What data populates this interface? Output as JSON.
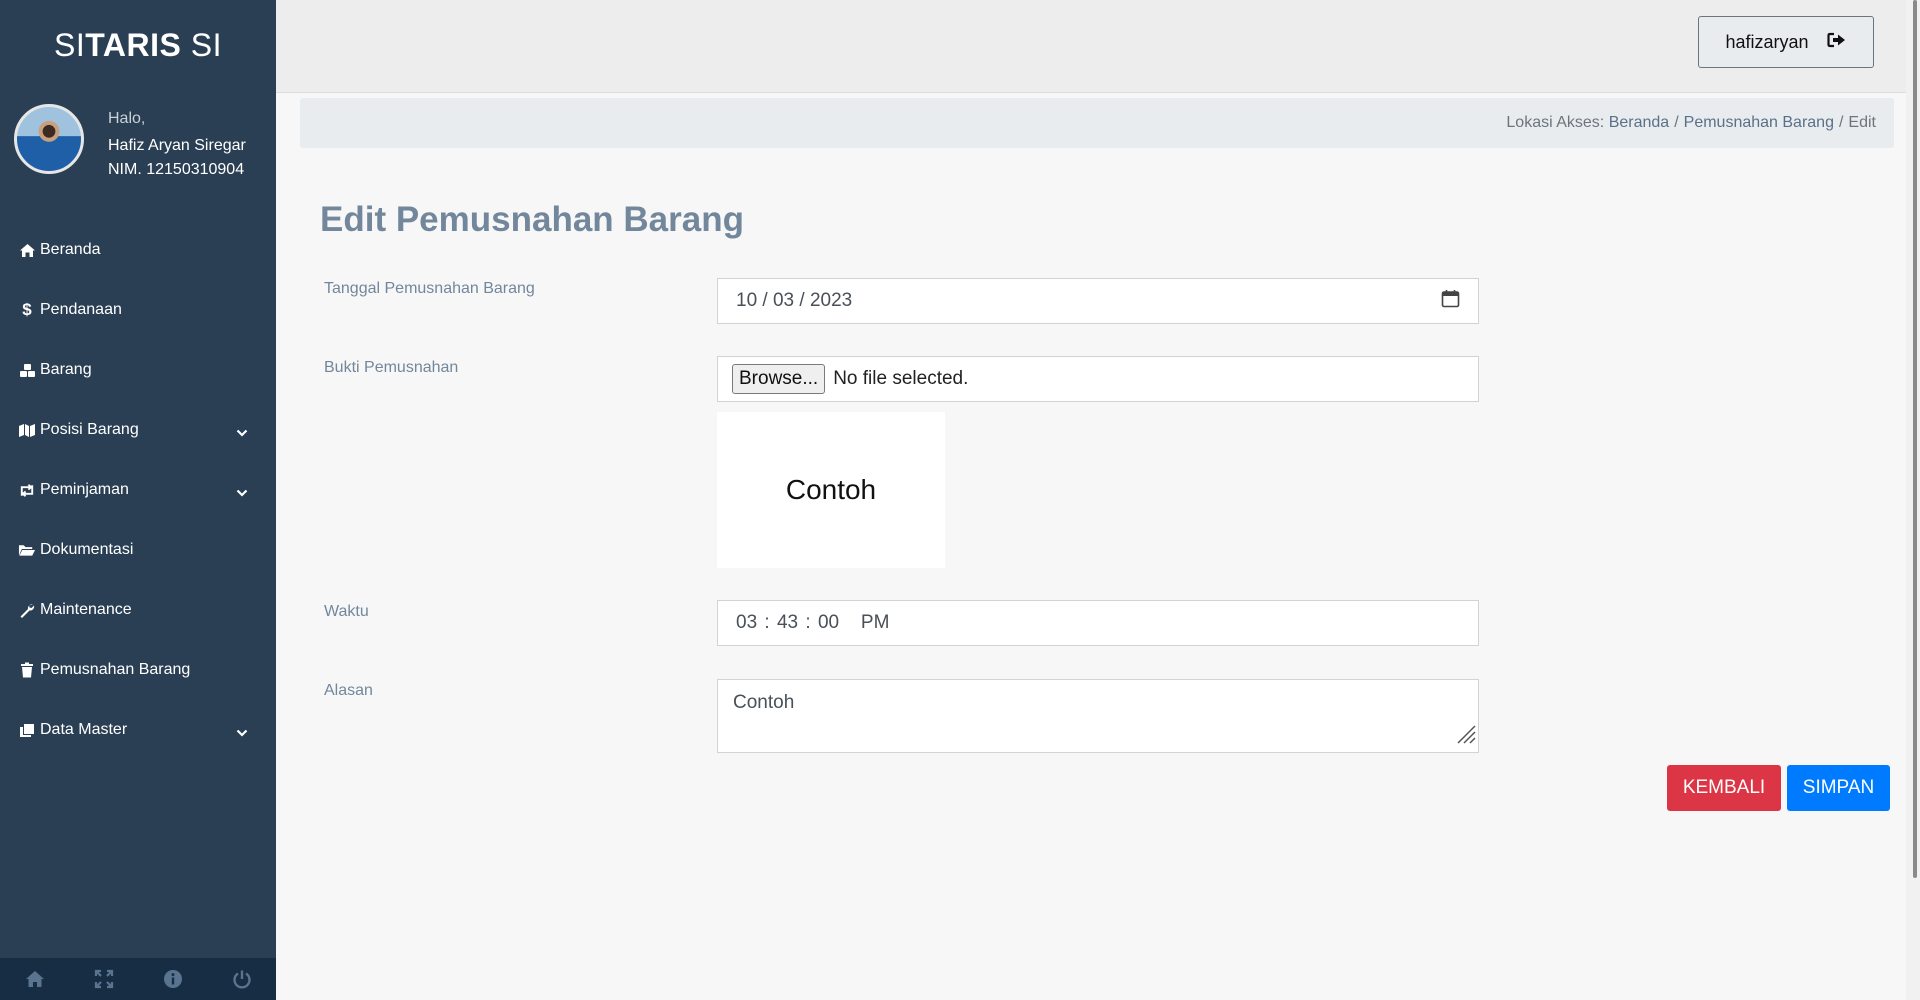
{
  "app": {
    "brand_prefix": "SI",
    "brand_bold": "TARIS",
    "brand_suffix": " SI"
  },
  "profile": {
    "greeting": "Halo,",
    "name": "Hafiz Aryan Siregar",
    "nim": "NIM. 12150310904"
  },
  "sidebar": {
    "items": [
      {
        "label": "Beranda",
        "icon": "home-icon"
      },
      {
        "label": "Pendanaan",
        "icon": "dollar-icon"
      },
      {
        "label": "Barang",
        "icon": "cubes-icon"
      },
      {
        "label": "Posisi Barang",
        "icon": "map-icon",
        "has_submenu": true
      },
      {
        "label": "Peminjaman",
        "icon": "retweet-icon",
        "has_submenu": true
      },
      {
        "label": "Dokumentasi",
        "icon": "folder-open-icon"
      },
      {
        "label": "Maintenance",
        "icon": "wrench-icon"
      },
      {
        "label": "Pemusnahan Barang",
        "icon": "trash-icon"
      },
      {
        "label": "Data Master",
        "icon": "clone-icon",
        "has_submenu": true
      }
    ],
    "footer_icons": [
      "home-icon",
      "fullscreen-icon",
      "info-icon",
      "power-icon"
    ]
  },
  "topnav": {
    "username": "hafizaryan",
    "logout_icon": "sign-out-icon"
  },
  "breadcrumb": {
    "prefix": "Lokasi Akses:",
    "items": [
      "Beranda",
      "Pemusnahan Barang",
      "Edit"
    ],
    "separator": "/"
  },
  "form": {
    "title": "Edit Pemusnahan Barang",
    "date_label": "Tanggal Pemusnahan Barang",
    "date_value": "10 / 03 / 2023",
    "proof_label": "Bukti Pemusnahan",
    "browse_label": "Browse...",
    "file_status": "No file selected.",
    "preview_text": "Contoh",
    "time_label": "Waktu",
    "time_value": "03 : 43 : 00   PM",
    "reason_label": "Alasan",
    "reason_value": "Contoh"
  },
  "actions": {
    "back_label": "KEMBALI",
    "save_label": "SIMPAN"
  },
  "colors": {
    "sidebar": "#2a3f54",
    "danger": "#dc3545",
    "primary": "#007bff",
    "title": "#73879c"
  }
}
